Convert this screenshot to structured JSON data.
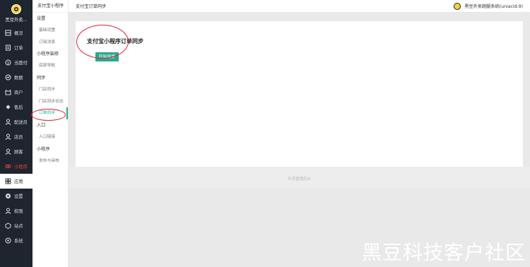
{
  "brand": {
    "name": "黑豆外卖..."
  },
  "nav": [
    {
      "label": "概况",
      "icon": "dashboard-icon"
    },
    {
      "label": "订单",
      "icon": "order-icon"
    },
    {
      "label": "当面付",
      "icon": "payment-icon"
    },
    {
      "label": "数据",
      "icon": "chart-icon"
    },
    {
      "label": "商户",
      "icon": "shop-icon"
    },
    {
      "label": "售后",
      "icon": "after-sales-icon"
    },
    {
      "label": "配送员",
      "icon": "courier-icon"
    },
    {
      "label": "店员",
      "icon": "staff-icon"
    },
    {
      "label": "顾客",
      "icon": "customer-icon"
    },
    {
      "label": "小程序",
      "icon": "mini-program-icon"
    },
    {
      "label": "应用",
      "icon": "apps-icon"
    },
    {
      "label": "设置",
      "icon": "gear-icon"
    },
    {
      "label": "权限",
      "icon": "permission-icon"
    },
    {
      "label": "站点",
      "icon": "site-icon"
    },
    {
      "label": "系统",
      "icon": "system-icon"
    }
  ],
  "sub": {
    "title": "支付宝小程序",
    "groups": [
      {
        "label": "设置",
        "items": [
          "基础设置",
          "订阅消息"
        ]
      },
      {
        "label": "小程序装修",
        "items": [
          "底部导航"
        ]
      },
      {
        "label": "同步",
        "items": [
          "门店同步",
          "门店同步状态",
          "订单同步"
        ]
      },
      {
        "label": "入口",
        "items": [
          "入口链接"
        ]
      },
      {
        "label": "小程序",
        "items": [
          "发布与审核"
        ]
      }
    ]
  },
  "topbar": {
    "breadcrumb": "支付宝订单同步",
    "user": "黑豆外卖跑腿系统(uniacid:9)"
  },
  "panel": {
    "title": "支付宝小程序订单同步",
    "button": "开始同步"
  },
  "footer": "外卖管理后台",
  "watermark": "黑豆科技客户社区",
  "colors": {
    "accent": "#2aa78e",
    "sidebar": "#1f252e",
    "annotation": "#e0202a"
  }
}
